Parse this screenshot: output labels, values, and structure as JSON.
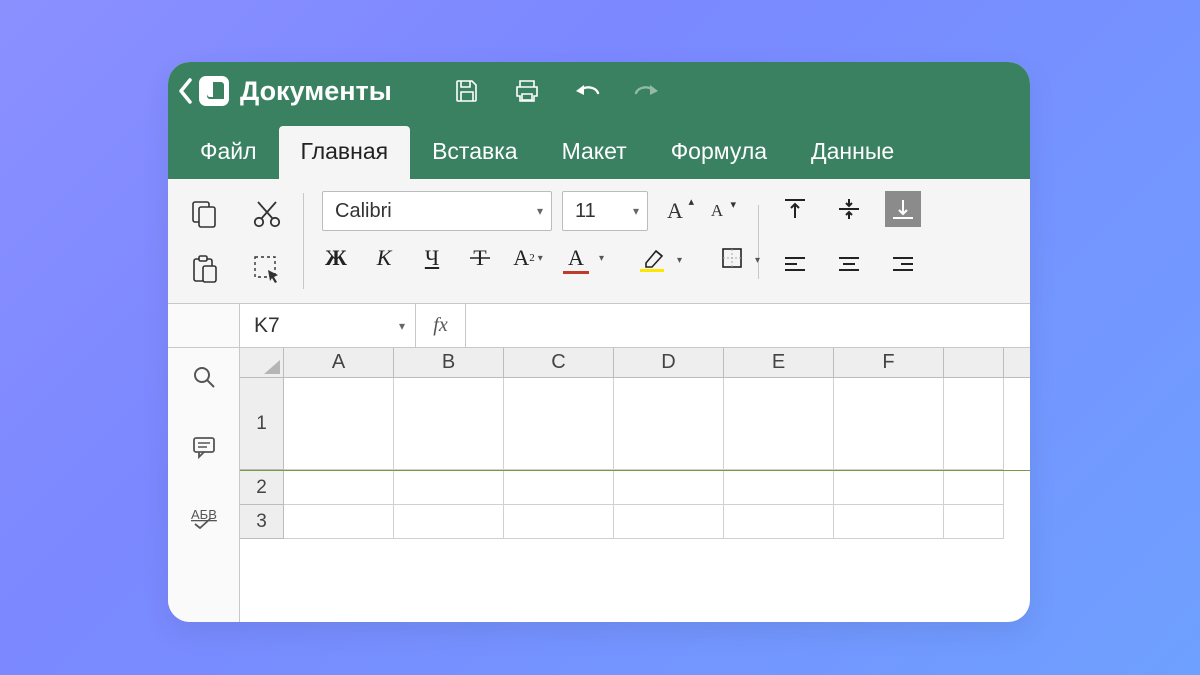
{
  "app": {
    "title": "Документы"
  },
  "tabs": {
    "t0": "Файл",
    "t1": "Главная",
    "t2": "Вставка",
    "t3": "Макет",
    "t4": "Формула",
    "t5": "Данные",
    "active_index": 1
  },
  "font": {
    "name": "Calibri",
    "size": "11"
  },
  "format_buttons": {
    "bold": "Ж",
    "italic": "К",
    "underline": "Ч",
    "strike": "Ŧ",
    "subscript": "A₂",
    "font_color_sample": "#c0392b",
    "highlight_sample": "#ffe600"
  },
  "namebox": {
    "ref": "K7"
  },
  "fx_label": "fx",
  "columns": [
    "A",
    "B",
    "C",
    "D",
    "E",
    "F"
  ],
  "rows": [
    "1",
    "2",
    "3"
  ],
  "colors": {
    "brand_green": "#3a8162",
    "ribbon_bg": "#f5f5f5"
  }
}
